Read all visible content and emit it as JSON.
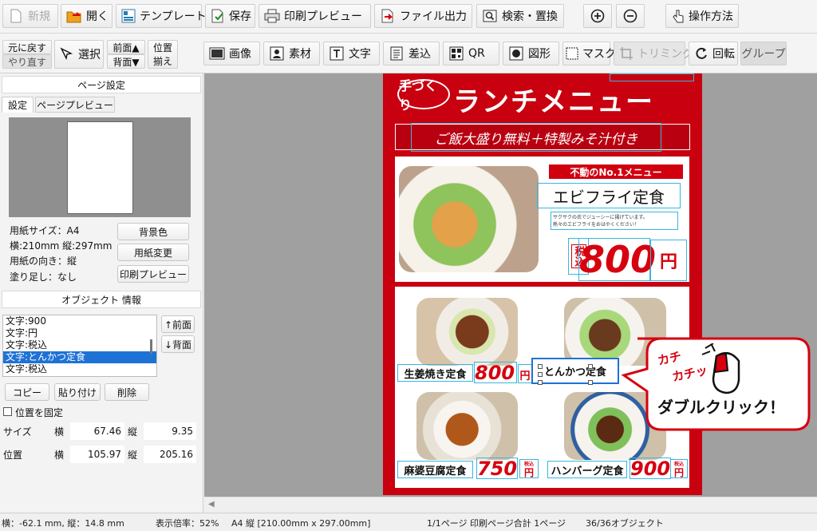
{
  "toolbar": {
    "new": "新規",
    "open": "開く",
    "template": "テンプレート",
    "save": "保存",
    "print_preview": "印刷プレビュー",
    "file_output": "ファイル出力",
    "search_replace": "検索・置換",
    "how_to": "操作方法"
  },
  "toolbar2": {
    "undo": "元に戻す",
    "redo": "やり直す",
    "select": "選択",
    "front": "前面▲",
    "back": "背面▼",
    "align_top": "位置",
    "align_bottom": "揃え",
    "image": "画像",
    "material": "素材",
    "text": "文字",
    "merge": "差込",
    "qr": "QR",
    "shape": "図形",
    "mask": "マスク",
    "trimming": "トリミング",
    "rotate": "回転",
    "group": "グループ"
  },
  "page_settings": {
    "header": "ページ設定",
    "tab_settings": "設定",
    "tab_preview": "ページプレビュー",
    "paper_size": "用紙サイズ：A4",
    "dimensions": "横:210mm 縦:297mm",
    "orientation": "用紙の向き：縦",
    "bleed": "塗り足し：なし",
    "bg_color_btn": "背景色",
    "change_paper_btn": "用紙変更",
    "print_preview_btn": "印刷プレビュー"
  },
  "object_info": {
    "header": "オブジェクト 情報",
    "items": [
      "文字:900",
      "文字:円",
      "文字:税込",
      "文字:とんかつ定食",
      "文字:税込"
    ],
    "selected_index": 3,
    "front_btn": "↑前面",
    "back_btn": "↓背面",
    "copy_btn": "コピー",
    "paste_btn": "貼り付け",
    "delete_btn": "削除",
    "fix_position": "位置を固定",
    "size_label": "サイズ",
    "pos_label": "位置",
    "w_label": "横",
    "h_label": "縦",
    "size_w": "67.46",
    "size_h": "9.35",
    "pos_x": "105.97",
    "pos_y": "205.16"
  },
  "status": {
    "coords": "横：-62.1 mm, 縦：14.8 mm",
    "zoom": "表示倍率：52%",
    "paper": "A4 縦 [210.00mm x 297.00mm]",
    "pages": "1/1ページ 印刷ページ合計 1ページ",
    "objects": "36/36オブジェクト"
  },
  "flyer": {
    "logo": "手づくり",
    "title": "ランチメニュー",
    "banner": "ご飯大盛り無料＋特製みそ汁付き",
    "no1_label": "不動のNo.1メニュー",
    "main_dish": "エビフライ定食",
    "desc1": "サクサクの衣でジューシーに揚げています。",
    "desc2": "熱々のエビフライをおはやくください！",
    "tax": "税込",
    "main_price": "800",
    "yen": "円",
    "items": [
      {
        "name": "生姜焼き定食",
        "price": "800",
        "yen": "円"
      },
      {
        "name": "とんかつ定食",
        "price": "",
        "yen": ""
      },
      {
        "name": "麻婆豆腐定食",
        "price": "750",
        "yen": "円"
      },
      {
        "name": "ハンバーグ定食",
        "price": "900",
        "yen": "円"
      }
    ],
    "tax_small": "税込"
  },
  "callout": {
    "sfx1": "カチ",
    "sfx2": "カチッ",
    "text": "ダブルクリック！"
  },
  "colors": {
    "flyer_red": "#c8000f",
    "select_blue": "#1e72d6",
    "price_red": "#d6000f"
  }
}
